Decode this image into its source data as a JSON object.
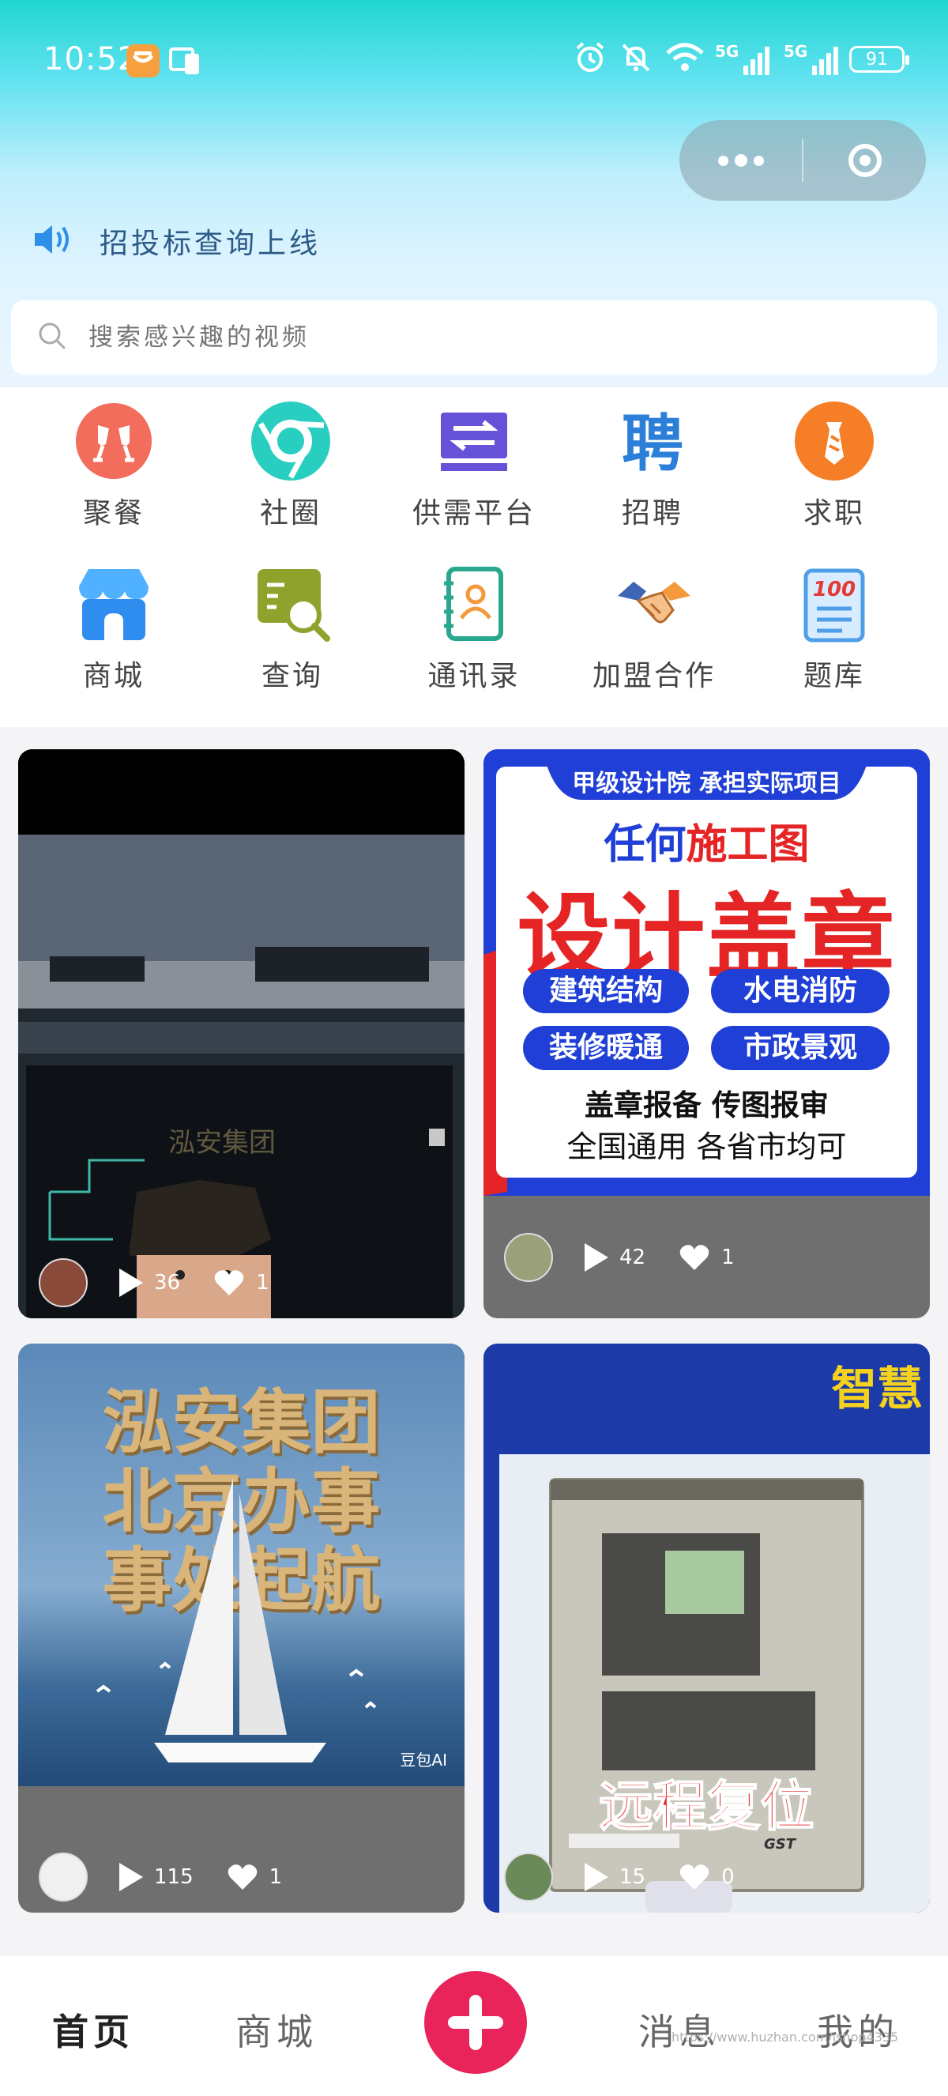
{
  "status_bar": {
    "time": "10:52",
    "network_1": "5G",
    "network_2": "5G",
    "battery": "91"
  },
  "notice": {
    "icon": "speaker-icon",
    "text": "招投标查询上线"
  },
  "search": {
    "placeholder": "搜索感兴趣的视频"
  },
  "menu": [
    {
      "label": "聚餐",
      "icon": "toast-cheers-icon",
      "color": "#f26d5b"
    },
    {
      "label": "社圈",
      "icon": "circle-ring-icon",
      "color": "#28cfc0"
    },
    {
      "label": "供需平台",
      "icon": "exchange-arrows-icon",
      "color": "#6552d9"
    },
    {
      "label": "招聘",
      "icon": "recruit-char-icon",
      "color": "#2b7fd9"
    },
    {
      "label": "求职",
      "icon": "tie-icon",
      "color": "#f57e27"
    },
    {
      "label": "商城",
      "icon": "store-icon",
      "color": "#2f8df0"
    },
    {
      "label": "查询",
      "icon": "search-document-icon",
      "color": "#8fa32c"
    },
    {
      "label": "通讯录",
      "icon": "contact-book-icon",
      "color": "#2aa88f"
    },
    {
      "label": "加盟合作",
      "icon": "handshake-icon",
      "color": "#3f66b5"
    },
    {
      "label": "题库",
      "icon": "quiz-score-icon",
      "color": "#4f9ee8"
    }
  ],
  "feed": [
    {
      "type": "video-cad",
      "overlay_text": "泓安集团",
      "plays": "36",
      "likes": "1"
    },
    {
      "type": "poster",
      "banner": "甲级设计院 承担实际项目",
      "line1_a": "任何",
      "line1_b": "施工图",
      "headline": "设计盖章",
      "tags": [
        "建筑结构",
        "水电消防",
        "装修暖通",
        "市政景观"
      ],
      "line3": "盖章报备 传图报审",
      "line4": "全国通用 各省市均可",
      "plays": "42",
      "likes": "1"
    },
    {
      "type": "poster-sail",
      "lines": [
        "泓安集团",
        "北京办事",
        "事处起航"
      ],
      "badge": "豆包AI",
      "plays": "115",
      "likes": "1"
    },
    {
      "type": "panel",
      "corner_text": "智慧",
      "brand": "GST",
      "headline": "远程复位",
      "plays": "15",
      "likes": "0"
    }
  ],
  "tabbar": {
    "home": "首页",
    "mall": "商城",
    "messages": "消息",
    "mine": "我的",
    "watermark": "https://www.huzhan.com/ishop4335"
  },
  "colors": {
    "accent": "#e8245a",
    "notice_text": "#2d5a86",
    "card_footer": "#6f6f6f"
  }
}
